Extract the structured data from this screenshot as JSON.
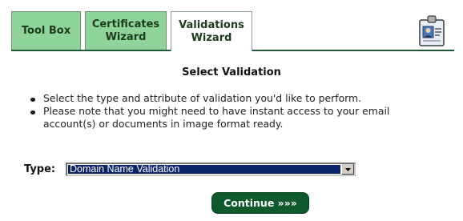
{
  "tabs": [
    {
      "label": "Tool Box",
      "active": false
    },
    {
      "label": "Certificates\nWizard",
      "active": false
    },
    {
      "label": "Validations\nWizard",
      "active": true
    }
  ],
  "header_icon": "id-badge-icon",
  "page_title": "Select Validation",
  "bullets": [
    "Select the type and attribute of validation you'd like to perform.",
    "Please note that you might need to have instant access to your email account(s) or documents in image format ready."
  ],
  "type_field": {
    "label": "Type:",
    "selected": "Domain Name Validation"
  },
  "continue_button": "Continue »»»",
  "colors": {
    "tab_inactive": "#8fd49a",
    "tab_line": "#1f5a3a",
    "button_bg": "#0f5a2c",
    "select_highlight": "#0a246a"
  }
}
